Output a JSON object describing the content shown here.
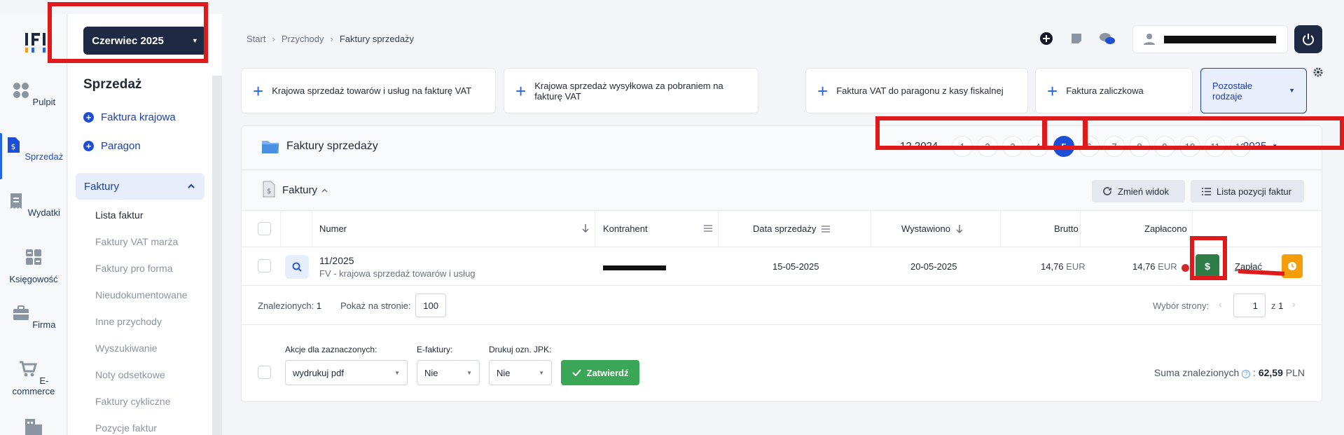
{
  "rail": {
    "items": [
      {
        "label": "Pulpit",
        "icon": "dashboard-icon"
      },
      {
        "label": "Sprzedaż",
        "icon": "invoice-icon"
      },
      {
        "label": "Wydatki",
        "icon": "receipt-icon"
      },
      {
        "label": "Księgowość",
        "icon": "calculator-icon"
      },
      {
        "label": "Firma",
        "icon": "briefcase-icon"
      },
      {
        "label": "E-commerce",
        "icon": "cart-icon"
      }
    ]
  },
  "menu": {
    "month_selector": "Czerwiec 2025",
    "section_title": "Sprzedaż",
    "actions": [
      "Faktura krajowa",
      "Paragon"
    ],
    "group_label": "Faktury",
    "items": [
      "Lista faktur",
      "Faktury VAT marża",
      "Faktury pro forma",
      "Nieudokumentowane",
      "Inne przychody",
      "Wyszukiwanie",
      "Noty odsetkowe",
      "Faktury cykliczne",
      "Pozycje faktur"
    ]
  },
  "breadcrumb": [
    "Start",
    "Przychody",
    "Faktury sprzedaży"
  ],
  "quick_cards": [
    "Krajowa sprzedaż towarów i usług na fakturę VAT",
    "Krajowa sprzedaż wysyłkowa za pobraniem na fakturę VAT",
    "Faktura VAT do paragonu z kasy fiskalnej",
    "Faktura zaliczkowa"
  ],
  "more_kinds": "Pozostałe rodzaje",
  "panel": {
    "title": "Faktury sprzedaży",
    "prev_period": "12.2024",
    "months": [
      "1",
      "2",
      "3",
      "4",
      "5",
      "6",
      "7",
      "8",
      "9",
      "10",
      "11",
      "12"
    ],
    "active_month": "5",
    "year": "2025",
    "sub_title": "Faktury",
    "change_view": "Zmień widok",
    "items_list": "Lista pozycji faktur"
  },
  "table": {
    "headers": {
      "numer": "Numer",
      "kontrahent": "Kontrahent",
      "data_sprzedazy": "Data sprzedaży",
      "wystawiono": "Wystawiono",
      "brutto": "Brutto",
      "zaplacono": "Zapłacono"
    },
    "rows": [
      {
        "numer": "11/2025",
        "typ": "FV - krajowa sprzedaż towarów i usług",
        "data_sprzedazy": "15-05-2025",
        "wystawiono": "20-05-2025",
        "brutto": "14,76",
        "brutto_waluta": "EUR",
        "zaplacono": "14,76",
        "zaplacono_waluta": "EUR",
        "pay_label": "Zapłać"
      }
    ]
  },
  "pager": {
    "found_label": "Znalezionych:",
    "found_count": "1",
    "per_page_label": "Pokaż na stronie:",
    "per_page": "100",
    "page_label": "Wybór strony:",
    "page": "1",
    "of": "z",
    "total_pages": "1"
  },
  "actions": {
    "bulk_label": "Akcje dla zaznaczonych:",
    "bulk_value": "wydrukuj pdf",
    "einvoice_label": "E-faktury:",
    "einvoice_value": "Nie",
    "jpk_label": "Drukuj ozn. JPK:",
    "jpk_value": "Nie",
    "confirm": "Zatwierdź",
    "sum_label": "Suma znalezionych",
    "sum_value": "62,59",
    "sum_currency": "PLN"
  },
  "colors": {
    "navy": "#1e2a44",
    "blue": "#1d4ed8",
    "green": "#2f7d46",
    "orange": "#f59e0b",
    "annotation": "#e01a1a"
  }
}
